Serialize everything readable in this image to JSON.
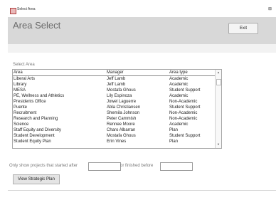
{
  "window": {
    "title": "Select Area",
    "close": "⊠"
  },
  "header": {
    "title": "Area Select",
    "exit_label": "Exit"
  },
  "list": {
    "section_label": "Select Area",
    "columns": [
      "Area",
      "Manager",
      "Area type"
    ],
    "rows": [
      [
        "Liberal Arts",
        "Jeff Lamb",
        "Academic"
      ],
      [
        "Library",
        "Jeff Lamb",
        "Academic"
      ],
      [
        "MESA",
        "Mostafa Ghous",
        "Student Support"
      ],
      [
        "PE, Wellness and Athletics",
        "Lily Espinoza",
        "Academic"
      ],
      [
        "Presidents Office",
        "Jowel Laguerre",
        "Non-Academic"
      ],
      [
        "Puente",
        "Abla Christiansen",
        "Student Support"
      ],
      [
        "Recruitment",
        "Shemila Johnson",
        "Non-Academic"
      ],
      [
        "Research and Planning",
        "Peter Cammish",
        "Non-Academic"
      ],
      [
        "Science",
        "Rennee Moore",
        "Academic"
      ],
      [
        "Staff Equity and Diversity",
        "Charo Albarran",
        "Plan"
      ],
      [
        "Student Development",
        "Mostafa Ghous",
        "Student Support"
      ],
      [
        "Student Equity Plan",
        "Erin Vines",
        "Plan"
      ]
    ],
    "scroll_up": "▲",
    "scroll_down": "▼"
  },
  "filter": {
    "started_label": "Only show projects that started after",
    "finished_label": "or finished before",
    "start_value": "",
    "end_value": ""
  },
  "buttons": {
    "view_plan": "View Strategic Plan"
  }
}
